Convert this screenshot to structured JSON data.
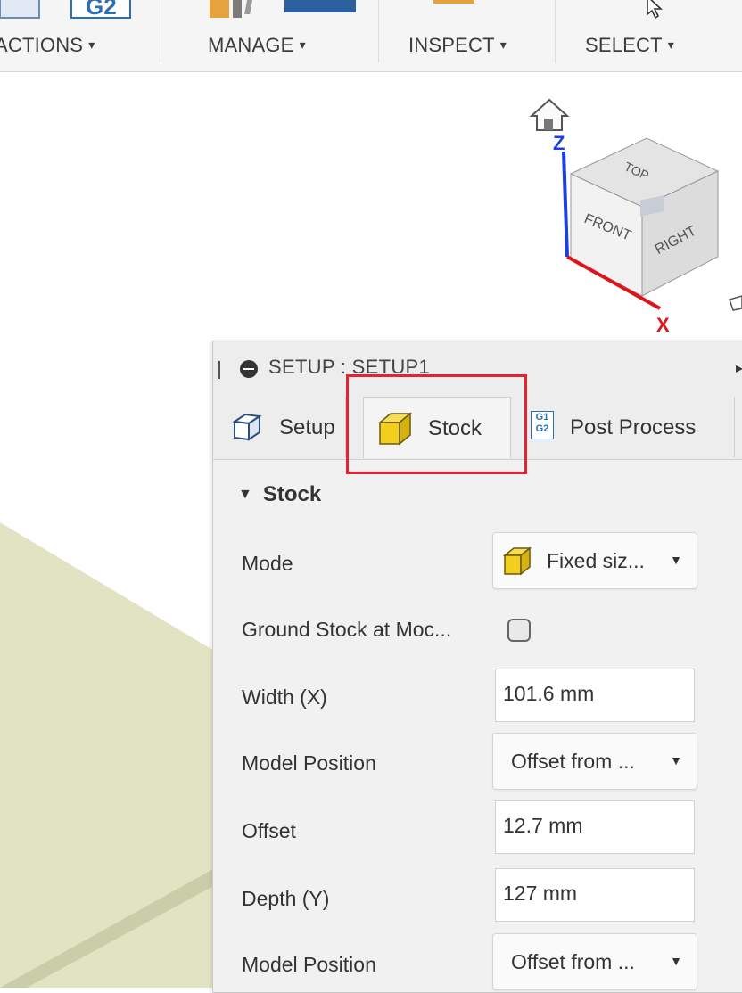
{
  "toolbar": {
    "groups": [
      {
        "label": "ACTIONS",
        "caret": "▾"
      },
      {
        "label": "MANAGE",
        "caret": "▾"
      },
      {
        "label": "INSPECT",
        "caret": "▾"
      },
      {
        "label": "SELECT",
        "caret": "▾"
      }
    ],
    "gcode_icon_text": "G2"
  },
  "viewcube": {
    "axis_z": "Z",
    "axis_x": "X",
    "face_top": "TOP",
    "face_front": "FRONT",
    "face_right": "RIGHT"
  },
  "panel": {
    "title": "SETUP : SETUP1",
    "tabs": [
      {
        "label": "Setup",
        "icon": "setup-cube-icon"
      },
      {
        "label": "Stock",
        "icon": "stock-cube-icon",
        "active": true
      },
      {
        "label": "Post Process",
        "icon": "gcode-icon",
        "icon_text_top": "G1",
        "icon_text_bottom": "G2"
      }
    ],
    "section": {
      "title": "Stock",
      "rows": [
        {
          "label": "Mode",
          "type": "dropdown",
          "value": "Fixed siz...",
          "icon": "stock-cube-icon"
        },
        {
          "label": "Ground Stock at Moc...",
          "type": "checkbox",
          "checked": false
        },
        {
          "label": "Width (X)",
          "type": "input",
          "value": "101.6 mm"
        },
        {
          "label": "Model Position",
          "type": "dropdown",
          "value": "Offset from ..."
        },
        {
          "label": "Offset",
          "type": "input",
          "value": "12.7 mm"
        },
        {
          "label": "Depth (Y)",
          "type": "input",
          "value": "127 mm"
        },
        {
          "label": "Model Position",
          "type": "dropdown",
          "value": "Offset from ..."
        }
      ]
    }
  },
  "colors": {
    "highlight": "#e8232f",
    "stock_yellow": "#f2cf1f",
    "model_face": "#e2e3c2",
    "model_edge": "#c9caa6",
    "axis_z": "#1b3fe0",
    "axis_x": "#e0131b"
  }
}
